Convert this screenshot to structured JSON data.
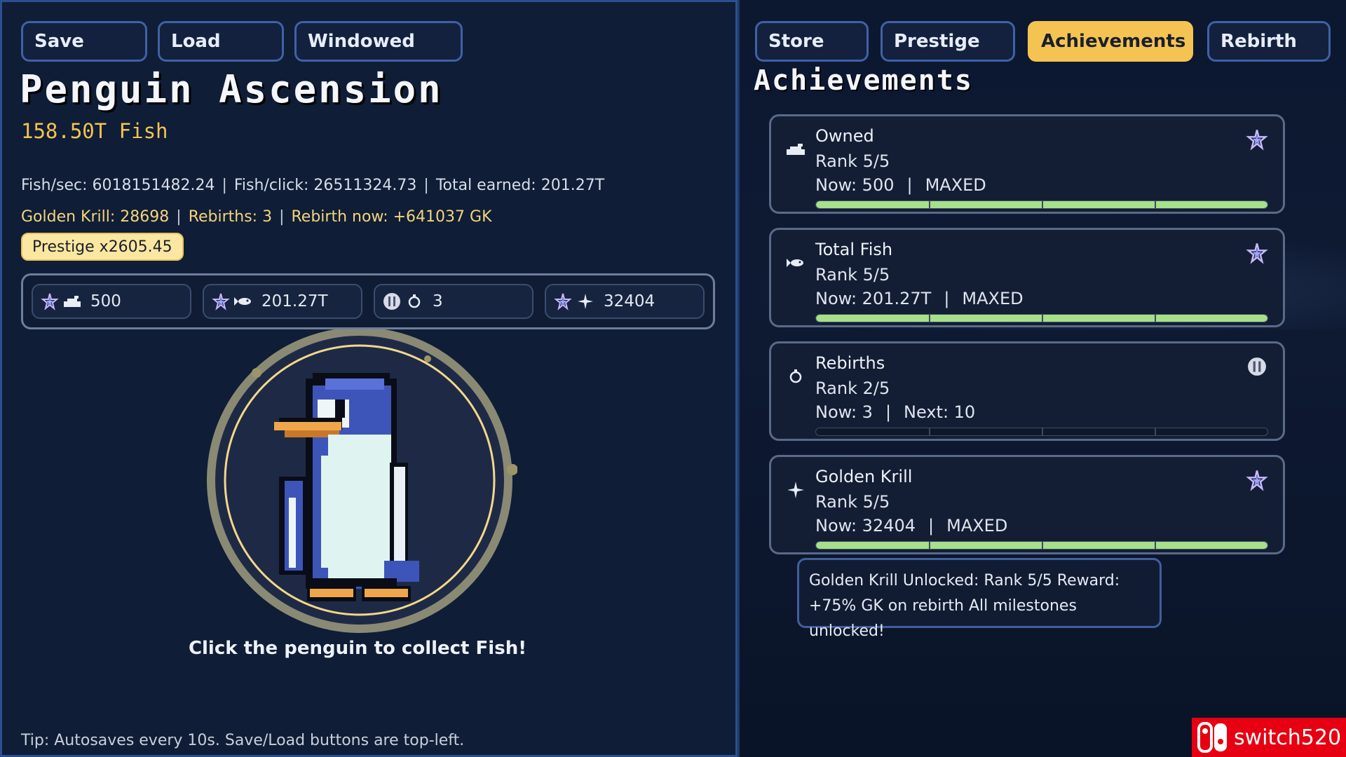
{
  "left": {
    "buttons": {
      "save": "Save",
      "load": "Load",
      "windowed": "Windowed"
    },
    "title": "Penguin Ascension",
    "fish_total": "158.50T Fish",
    "stats": {
      "fish_per_sec": "Fish/sec: 6018151482.24",
      "fish_per_click": "Fish/click: 26511324.73",
      "total_earned": "Total earned: 201.27T",
      "golden_krill": "Golden Krill: 28698",
      "rebirths": "Rebirths: 3",
      "rebirth_now": "Rebirth now: +641037 GK",
      "separator": "|"
    },
    "prestige_badge": "Prestige x2605.45",
    "summary": [
      {
        "value": "500",
        "icons": [
          "star-badge-icon",
          "igloo-icon"
        ]
      },
      {
        "value": "201.27T",
        "icons": [
          "star-badge-icon",
          "fish-icon"
        ]
      },
      {
        "value": "3",
        "icons": [
          "pause-icon",
          "cycle-icon"
        ]
      },
      {
        "value": "32404",
        "icons": [
          "star-badge-icon",
          "sparkle-icon"
        ]
      }
    ],
    "caption": "Click the penguin to collect Fish!",
    "tip": "Tip: Autosaves every 10s. Save/Load buttons are top-left."
  },
  "right": {
    "tabs": {
      "store": "Store",
      "prestige": "Prestige",
      "achievements": "Achievements",
      "rebirth": "Rebirth"
    },
    "active_tab": "achievements",
    "title": "Achievements",
    "cards": [
      {
        "name": "Owned",
        "rank": "Rank 5/5",
        "now": "Now: 500",
        "status": "MAXED",
        "progress": 1.0,
        "icon": "igloo-icon",
        "badge": "star-badge-icon"
      },
      {
        "name": "Total Fish",
        "rank": "Rank 5/5",
        "now": "Now: 201.27T",
        "status": "MAXED",
        "progress": 1.0,
        "icon": "fish-icon",
        "badge": "star-badge-icon"
      },
      {
        "name": "Rebirths",
        "rank": "Rank 2/5",
        "now": "Now: 3",
        "status": "Next: 10",
        "progress": 0.0,
        "icon": "cycle-icon",
        "badge": "pause-icon"
      },
      {
        "name": "Golden Krill",
        "rank": "Rank 5/5",
        "now": "Now: 32404",
        "status": "MAXED",
        "progress": 1.0,
        "icon": "sparkle-icon",
        "badge": "star-badge-icon"
      }
    ],
    "tooltip": {
      "line1": "Golden Krill Unlocked: Rank 5/5 Reward:",
      "line2": "+75% GK on rebirth All milestones unlocked!"
    }
  },
  "watermark": "switch520",
  "colors": {
    "accent": "#f4c352",
    "progress": "#a6e08a",
    "panel_border": "#2b4f8f",
    "watermark_bg": "#e60012"
  }
}
